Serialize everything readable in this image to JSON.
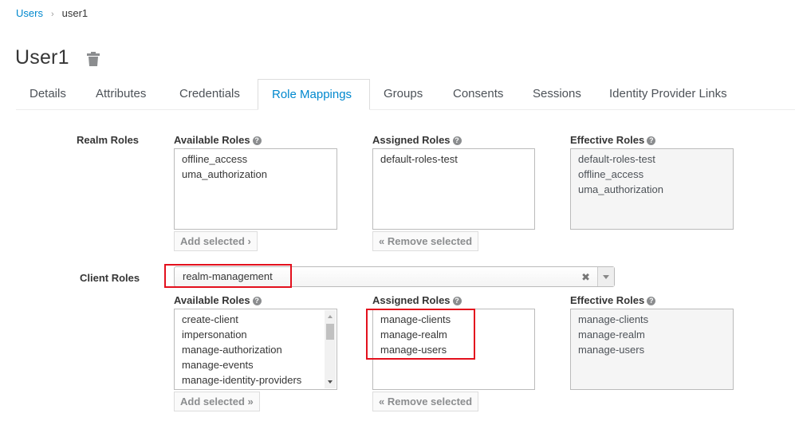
{
  "breadcrumb": {
    "parent": "Users",
    "separator": "›",
    "current": "user1"
  },
  "page_title": "User1",
  "tabs": [
    {
      "label": "Details",
      "active": false
    },
    {
      "label": "Attributes",
      "active": false
    },
    {
      "label": "Credentials",
      "active": false
    },
    {
      "label": "Role Mappings",
      "active": true
    },
    {
      "label": "Groups",
      "active": false
    },
    {
      "label": "Consents",
      "active": false
    },
    {
      "label": "Sessions",
      "active": false
    },
    {
      "label": "Identity Provider Links",
      "active": false
    }
  ],
  "realm_roles": {
    "label": "Realm Roles",
    "available": {
      "label": "Available Roles",
      "items": [
        "offline_access",
        "uma_authorization"
      ],
      "button": "Add selected ›"
    },
    "assigned": {
      "label": "Assigned Roles",
      "items": [
        "default-roles-test"
      ],
      "button": "« Remove selected"
    },
    "effective": {
      "label": "Effective Roles",
      "items": [
        "default-roles-test",
        "offline_access",
        "uma_authorization"
      ]
    }
  },
  "client_roles": {
    "label": "Client Roles",
    "client_select": {
      "value": "realm-management",
      "clear": "✖"
    },
    "available": {
      "label": "Available Roles",
      "items": [
        "create-client",
        "impersonation",
        "manage-authorization",
        "manage-events",
        "manage-identity-providers"
      ],
      "button": "Add selected »"
    },
    "assigned": {
      "label": "Assigned Roles",
      "items": [
        "manage-clients",
        "manage-realm",
        "manage-users"
      ],
      "button": "« Remove selected"
    },
    "effective": {
      "label": "Effective Roles",
      "items": [
        "manage-clients",
        "manage-realm",
        "manage-users"
      ]
    }
  },
  "help_glyph": "?",
  "colors": {
    "link": "#0088ce",
    "highlight": "#e3101d"
  }
}
